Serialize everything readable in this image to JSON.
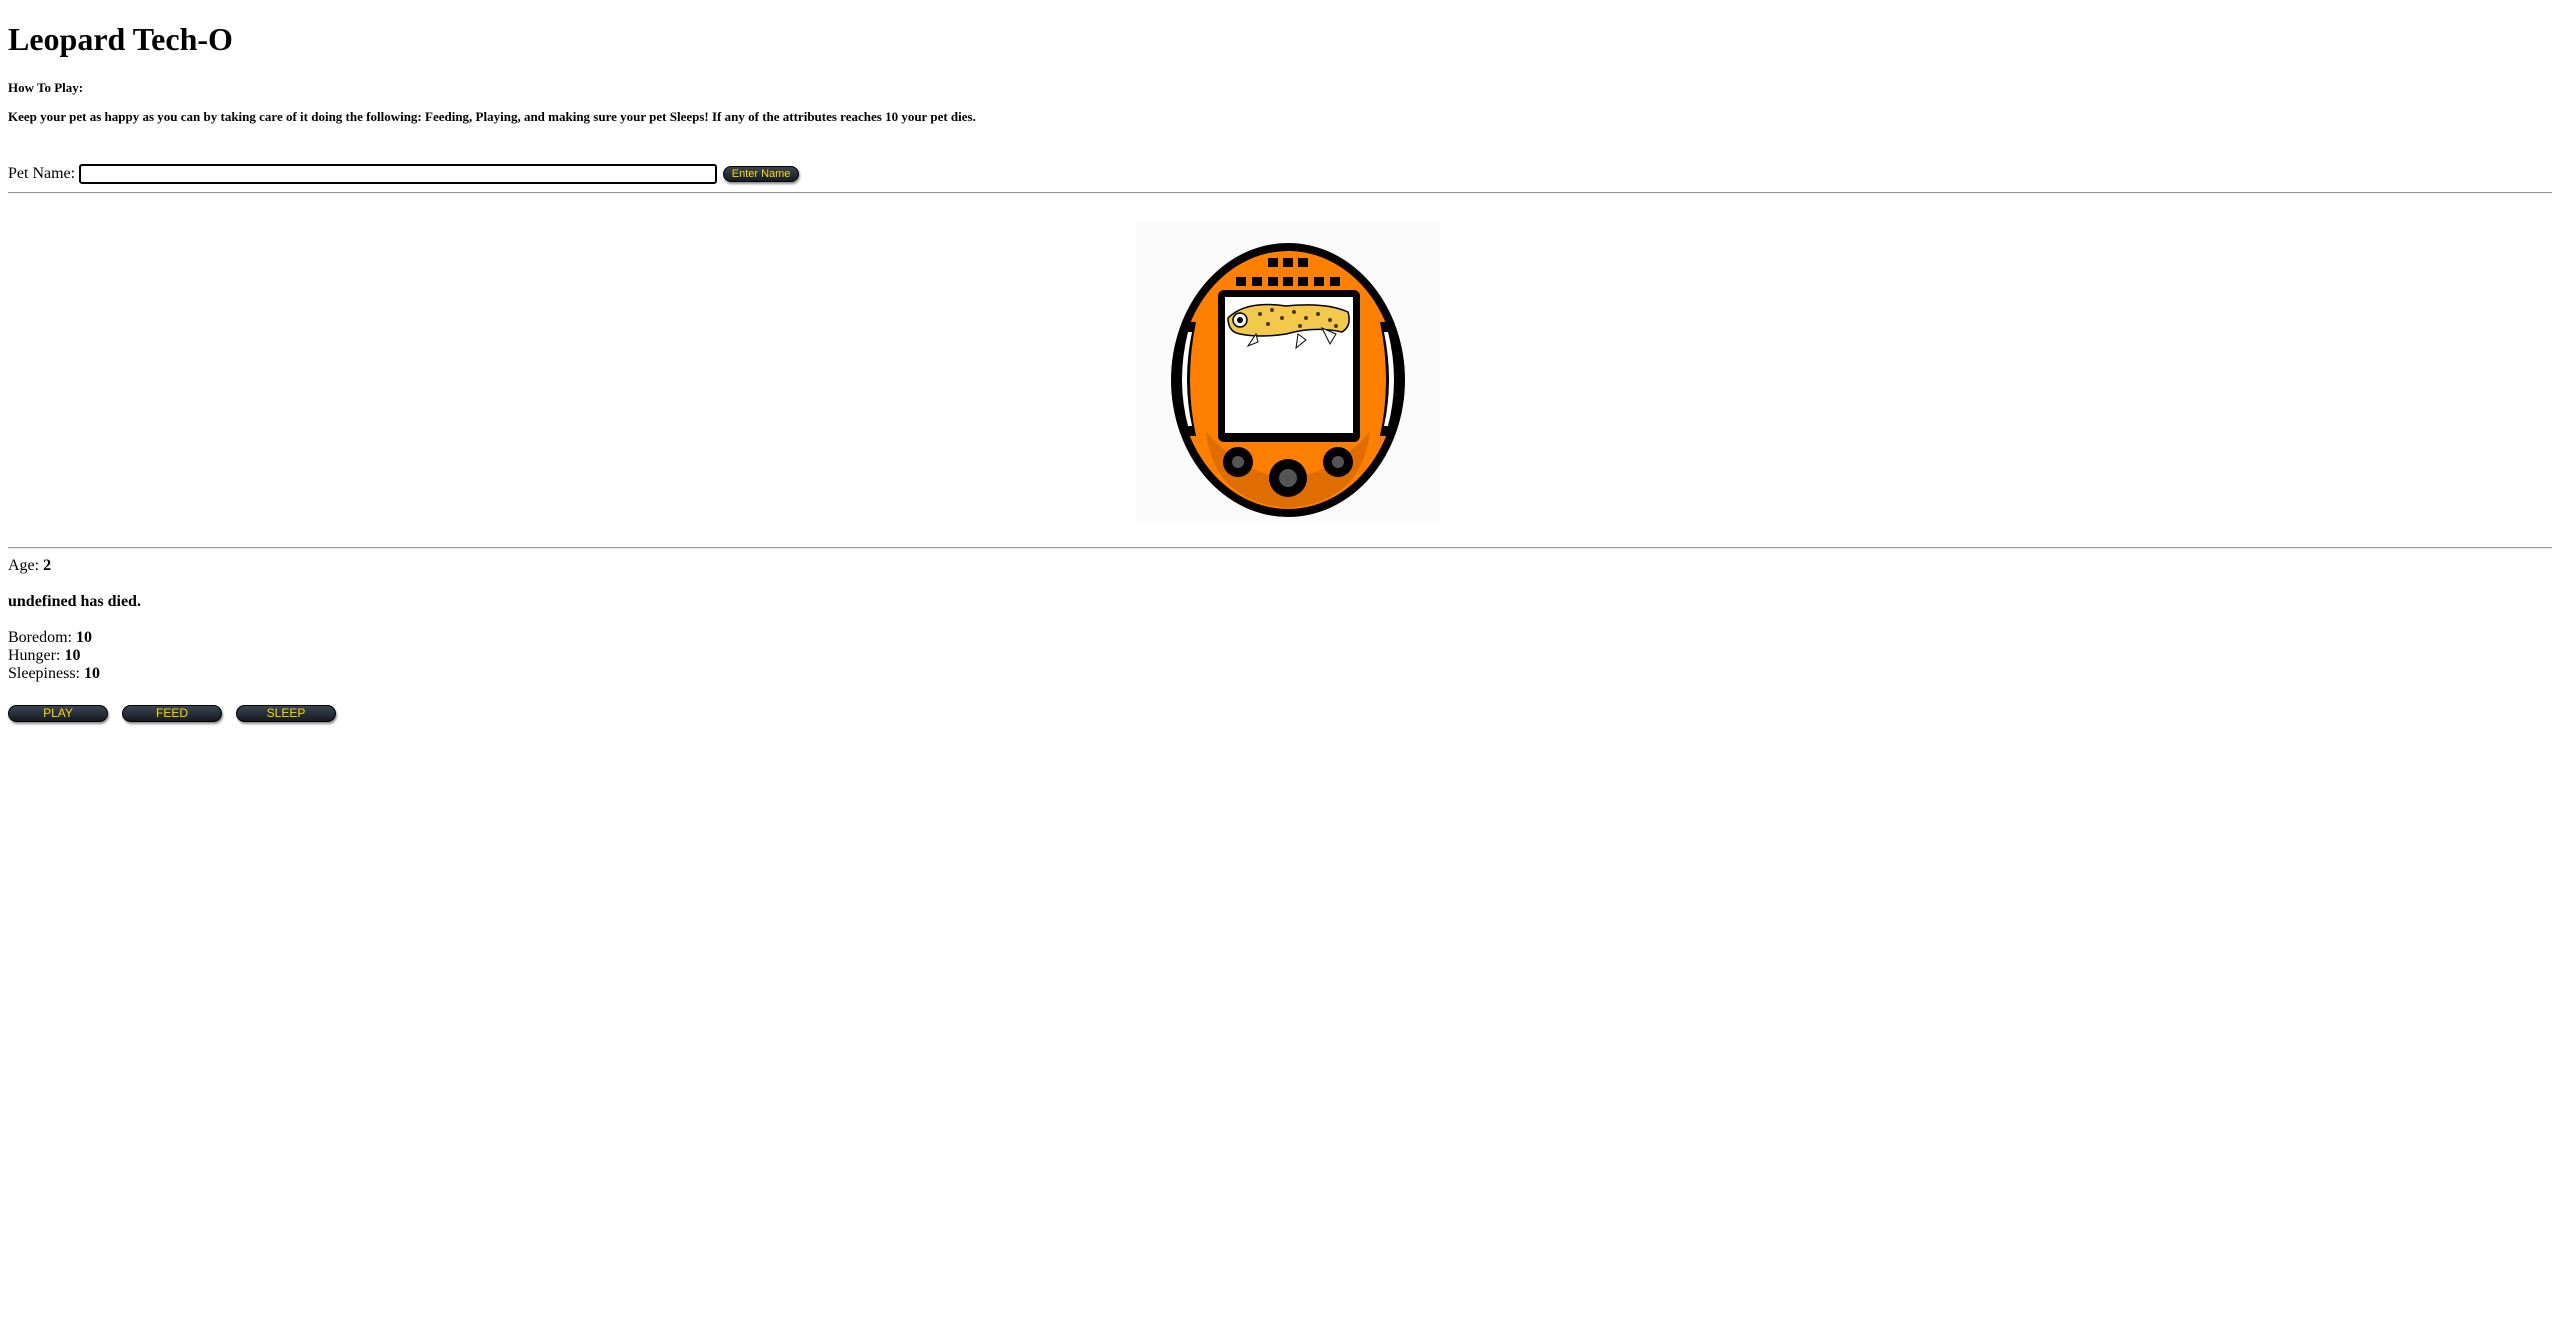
{
  "app": {
    "title": "Leopard Tech-O"
  },
  "instructions": {
    "heading": "How To Play:",
    "body": "Keep your pet as happy as you can by taking care of it doing the following: Feeding, Playing, and making sure your pet Sleeps! If any of the attributes reaches 10 your pet dies."
  },
  "name_form": {
    "label": "Pet Name:",
    "input_value": "",
    "button_label": "Enter Name"
  },
  "device": {
    "icon": "tamagotchi-device-with-leopard-gecko",
    "shell_color": "#ff8000",
    "outline_color": "#000000"
  },
  "pet": {
    "age_label": "Age:",
    "age_value": "2",
    "status_message": "undefined has died.",
    "stats": [
      {
        "label": "Boredom:",
        "value": "10"
      },
      {
        "label": "Hunger:",
        "value": "10"
      },
      {
        "label": "Sleepiness:",
        "value": "10"
      }
    ]
  },
  "actions": {
    "play_label": "PLAY",
    "feed_label": "FEED",
    "sleep_label": "SLEEP"
  },
  "colors": {
    "button_bg": "#1f2630",
    "button_text": "#ffd700"
  }
}
